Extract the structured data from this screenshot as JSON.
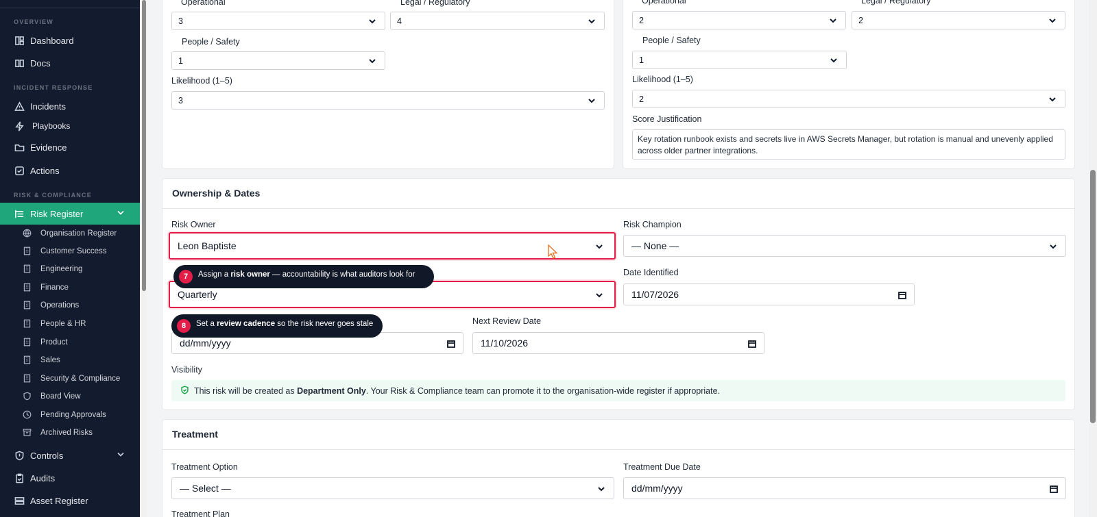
{
  "sidebar": {
    "sections": {
      "overview": "OVERVIEW",
      "incident": "INCIDENT RESPONSE",
      "risk": "RISK & COMPLIANCE"
    },
    "items": {
      "dashboard": "Dashboard",
      "docs": "Docs",
      "incidents": "Incidents",
      "playbooks": "Playbooks",
      "evidence": "Evidence",
      "actions": "Actions",
      "risk_register": "Risk Register",
      "controls": "Controls",
      "audits": "Audits",
      "asset_register": "Asset Register"
    },
    "risk_sub": [
      "Organisation Register",
      "Customer Success",
      "Engineering",
      "Finance",
      "Operations",
      "People & HR",
      "Product",
      "Sales",
      "Security & Compliance",
      "Board View",
      "Pending Approvals",
      "Archived Risks"
    ]
  },
  "inherent": {
    "operational_label": "Operational",
    "operational_value": "3",
    "legal_label": "Legal / Regulatory",
    "legal_value": "4",
    "people_label": "People / Safety",
    "people_value": "1",
    "likelihood_label": "Likelihood (1–5)",
    "likelihood_value": "3"
  },
  "residual": {
    "operational_label": "Operational",
    "operational_value": "2",
    "legal_label": "Legal / Regulatory",
    "legal_value": "2",
    "people_label": "People / Safety",
    "people_value": "1",
    "likelihood_label": "Likelihood (1–5)",
    "likelihood_value": "2",
    "justification_label": "Score Justification",
    "justification_text": "Key rotation runbook exists and secrets live in AWS Secrets Manager, but rotation is manual and unevenly applied across older partner integrations."
  },
  "ownership": {
    "title": "Ownership & Dates",
    "risk_owner_label": "Risk Owner",
    "risk_owner_value": "Leon Baptiste",
    "risk_champion_label": "Risk Champion",
    "risk_champion_value": "— None —",
    "review_cadence_value": "Quarterly",
    "date_identified_label": "Date Identified",
    "date_identified_value": "11/07/2026",
    "last_review_value": "dd/mm/yyyy",
    "next_review_label": "Next Review Date",
    "next_review_value": "11/10/2026",
    "visibility_label": "Visibility",
    "visibility_pre": "This risk will be created as ",
    "visibility_bold": "Department Only",
    "visibility_post": ". Your Risk & Compliance team can promote it to the organisation-wide register if appropriate."
  },
  "tips": {
    "t7_num": "7",
    "t7_pre": "Assign a ",
    "t7_bold": "risk owner",
    "t7_post": " — accountability is what auditors look for",
    "t8_num": "8",
    "t8_pre": "Set a ",
    "t8_bold": "review cadence",
    "t8_post": " so the risk never goes stale"
  },
  "treatment": {
    "title": "Treatment",
    "option_label": "Treatment Option",
    "option_value": "— Select —",
    "due_label": "Treatment Due Date",
    "due_value": "dd/mm/yyyy",
    "plan_label": "Treatment Plan"
  },
  "colors": {
    "accent": "#1fa67a",
    "highlight": "#e11d48",
    "sidebar_bg": "#131b2e"
  }
}
